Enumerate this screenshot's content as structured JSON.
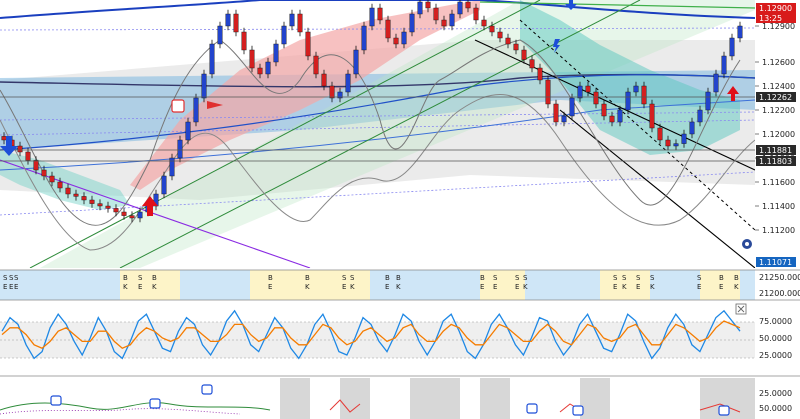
{
  "chart_data": [
    {
      "type": "candlestick",
      "panel": "main",
      "y_ticks": [
        1.129,
        1.126,
        1.124,
        1.122,
        1.12,
        1.118,
        1.116,
        1.114,
        1.112
      ],
      "ylim": [
        1.1095,
        1.1305
      ],
      "price_tags": [
        {
          "value": "1.12900",
          "color": "#d81b1b"
        },
        {
          "value": "13:25",
          "color": "#d81b1b"
        },
        {
          "value": "1.12262",
          "color": "#2a2a2a"
        },
        {
          "value": "1.11881",
          "color": "#2a2a2a"
        },
        {
          "value": "1.11803",
          "color": "#2a2a2a"
        },
        {
          "value": "1.11071",
          "color": "#1565c0"
        }
      ],
      "close_series": [
        1.1195,
        1.119,
        1.1185,
        1.1178,
        1.117,
        1.1165,
        1.116,
        1.1155,
        1.115,
        1.1148,
        1.1145,
        1.1142,
        1.114,
        1.1138,
        1.1135,
        1.1132,
        1.113,
        1.1135,
        1.114,
        1.115,
        1.1165,
        1.118,
        1.1195,
        1.121,
        1.123,
        1.125,
        1.1275,
        1.129,
        1.13,
        1.1285,
        1.127,
        1.1255,
        1.125,
        1.126,
        1.1275,
        1.129,
        1.13,
        1.1285,
        1.1265,
        1.125,
        1.124,
        1.123,
        1.1235,
        1.125,
        1.127,
        1.129,
        1.1305,
        1.1295,
        1.128,
        1.1275,
        1.1285,
        1.13,
        1.131,
        1.1305,
        1.1295,
        1.129,
        1.13,
        1.131,
        1.1305,
        1.1295,
        1.129,
        1.1285,
        1.128,
        1.1275,
        1.127,
        1.1262,
        1.1255,
        1.1245,
        1.1225,
        1.121,
        1.1215,
        1.123,
        1.124,
        1.1235,
        1.1225,
        1.1215,
        1.121,
        1.122,
        1.1235,
        1.124,
        1.1225,
        1.1205,
        1.1195,
        1.119,
        1.1192,
        1.12,
        1.121,
        1.122,
        1.1235,
        1.125,
        1.1265,
        1.128,
        1.129
      ]
    },
    {
      "type": "event_strip",
      "panel": "sessions",
      "y_ticks": [
        "21250.00000",
        "21200.00000"
      ],
      "labels": [
        {
          "top": "S",
          "bottom": "E"
        },
        {
          "top": "S",
          "bottom": "E"
        },
        {
          "top": "S",
          "bottom": "E"
        },
        {
          "top": "B",
          "bottom": "K"
        },
        {
          "top": "S",
          "bottom": "E"
        },
        {
          "top": "B",
          "bottom": "K"
        },
        {
          "top": "B",
          "bottom": "E"
        },
        {
          "top": "B",
          "bottom": "K"
        },
        {
          "top": "S",
          "bottom": "E"
        },
        {
          "top": "S",
          "bottom": "K"
        },
        {
          "top": "B",
          "bottom": "E"
        },
        {
          "top": "B",
          "bottom": "K"
        },
        {
          "top": "B",
          "bottom": "E"
        },
        {
          "top": "S",
          "bottom": "E"
        },
        {
          "top": "S",
          "bottom": "E"
        },
        {
          "top": "S",
          "bottom": "K"
        },
        {
          "top": "S",
          "bottom": "E"
        },
        {
          "top": "S",
          "bottom": "K"
        },
        {
          "top": "S",
          "bottom": "E"
        },
        {
          "top": "S",
          "bottom": "K"
        },
        {
          "top": "S",
          "bottom": "E"
        },
        {
          "top": "B",
          "bottom": "E"
        },
        {
          "top": "B",
          "bottom": "K"
        }
      ]
    },
    {
      "type": "line",
      "panel": "stochastic",
      "y_ticks": [
        "75.0000",
        "50.0000",
        "25.0000"
      ],
      "ylim": [
        0,
        100
      ],
      "series": [
        {
          "color": "#1e88e5",
          "values": [
            60,
            80,
            70,
            40,
            20,
            30,
            65,
            85,
            70,
            45,
            25,
            50,
            80,
            60,
            30,
            20,
            45,
            75,
            85,
            60,
            35,
            30,
            60,
            80,
            70,
            40,
            25,
            45,
            75,
            90,
            70,
            40,
            30,
            55,
            80,
            65,
            35,
            20,
            40,
            70,
            85,
            60,
            30,
            25,
            50,
            80,
            70,
            45,
            30,
            55,
            85,
            75,
            45,
            25,
            45,
            75,
            85,
            60,
            30,
            20,
            40,
            70,
            85,
            65,
            40,
            25,
            50,
            80,
            75,
            45,
            25,
            40,
            70,
            85,
            60,
            35,
            30,
            55,
            85,
            75,
            45,
            20,
            35,
            65,
            85,
            70,
            40,
            30,
            55,
            80,
            90,
            75,
            60
          ]
        },
        {
          "color": "#f57c00",
          "values": [
            55,
            65,
            65,
            55,
            40,
            35,
            45,
            60,
            65,
            55,
            45,
            45,
            60,
            60,
            45,
            35,
            40,
            55,
            65,
            60,
            50,
            45,
            50,
            65,
            65,
            55,
            45,
            45,
            55,
            70,
            70,
            55,
            45,
            50,
            65,
            65,
            50,
            40,
            40,
            55,
            70,
            65,
            50,
            40,
            45,
            60,
            65,
            55,
            45,
            50,
            65,
            70,
            55,
            45,
            45,
            60,
            70,
            65,
            50,
            40,
            40,
            55,
            70,
            65,
            55,
            45,
            45,
            60,
            70,
            60,
            45,
            40,
            55,
            70,
            65,
            50,
            45,
            50,
            65,
            70,
            55,
            40,
            40,
            55,
            70,
            65,
            55,
            45,
            50,
            65,
            75,
            70,
            65
          ]
        }
      ]
    },
    {
      "type": "line",
      "panel": "oscillator",
      "y_ticks": [
        "50.0000",
        "25.0000"
      ]
    }
  ],
  "icons": {
    "buy_arrow": "up-arrow-icon",
    "sell_arrow": "down-arrow-icon",
    "thumbs": "thumbs-down-icon",
    "close_box": "close-icon",
    "settings": "gear-icon"
  }
}
